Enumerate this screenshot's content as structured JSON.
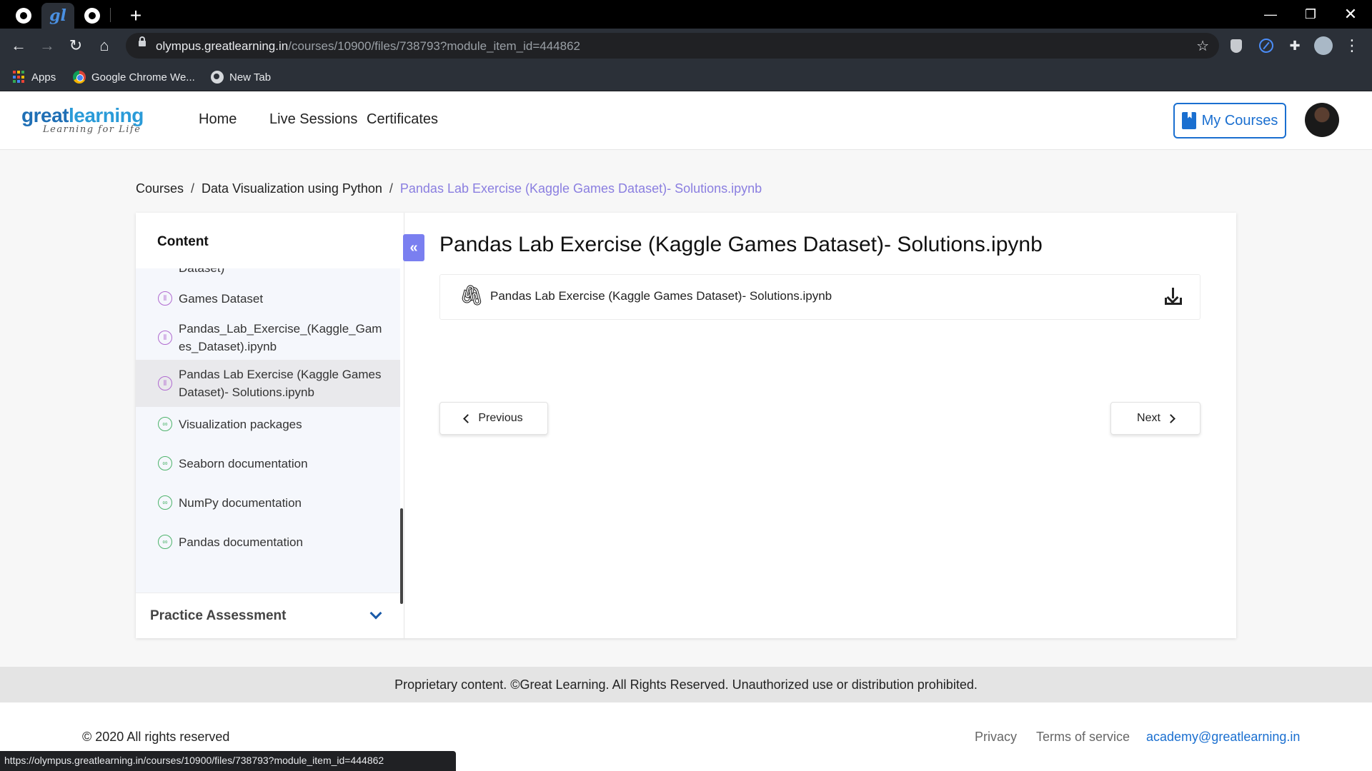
{
  "browser": {
    "url_host": "olympus.greatlearning.in",
    "url_path": "/courses/10900/files/738793?module_item_id=444862",
    "bookmarks": [
      {
        "label": "Apps"
      },
      {
        "label": "Google Chrome We..."
      },
      {
        "label": "New Tab"
      }
    ],
    "status_url": "https://olympus.greatlearning.in/courses/10900/files/738793?module_item_id=444862"
  },
  "header": {
    "logo_main_a": "great",
    "logo_main_b": "learning",
    "logo_sub": "Learning for Life",
    "nav": [
      "Home",
      "Live Sessions",
      "Certificates"
    ],
    "my_courses_label": "My Courses"
  },
  "breadcrumb": {
    "items": [
      "Courses",
      "Data Visualization using Python"
    ],
    "current": "Pandas Lab Exercise (Kaggle Games Dataset)- Solutions.ipynb"
  },
  "sidebar": {
    "heading": "Content",
    "clipped_text": "Dataset)",
    "items": [
      {
        "label": "Games Dataset",
        "icon": "file-icon"
      },
      {
        "label": "Pandas_Lab_Exercise_(Kaggle_Gam es_Dataset).ipynb",
        "icon": "file-icon"
      },
      {
        "label": "Pandas Lab Exercise (Kaggle Games Dataset)- Solutions.ipynb",
        "icon": "file-icon",
        "active": true
      },
      {
        "label": "Visualization packages",
        "icon": "link-icon"
      },
      {
        "label": "Seaborn documentation",
        "icon": "link-icon"
      },
      {
        "label": "NumPy documentation",
        "icon": "link-icon"
      },
      {
        "label": "Pandas documentation",
        "icon": "link-icon"
      }
    ],
    "section": "Practice Assessment"
  },
  "main": {
    "title": "Pandas Lab Exercise (Kaggle Games Dataset)- Solutions.ipynb",
    "file_name": "Pandas Lab Exercise (Kaggle Games Dataset)- Solutions.ipynb",
    "previous_label": "Previous",
    "next_label": "Next"
  },
  "footer": {
    "proprietary": "Proprietary content. ©Great Learning. All Rights Reserved. Unauthorized use or distribution prohibited.",
    "copyright": "© 2020 All rights reserved",
    "privacy": "Privacy",
    "terms": "Terms of service",
    "email": "academy@greatlearning.in"
  },
  "colors": {
    "accent_purple": "#8a7ee0",
    "brand_blue": "#1a6fd0",
    "collapse_button": "#7a7ff0"
  }
}
